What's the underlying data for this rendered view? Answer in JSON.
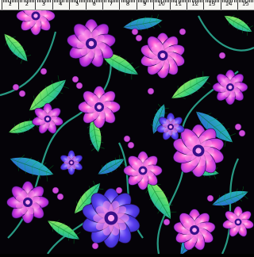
{
  "ruler": {
    "numbers": [
      "1",
      "2",
      "3",
      "4",
      "5",
      "6",
      "7",
      "8",
      "9",
      "10",
      "11",
      "12",
      "13",
      "14",
      "15"
    ]
  },
  "fabric": {
    "background": "#050308",
    "palette": [
      "#7b1fd6",
      "#b43bff",
      "#e040d0",
      "#ff5fd7",
      "#3b3bd8",
      "#1f7fd0",
      "#22b6a6",
      "#3fd27a",
      "#8fe04a",
      "#c6f06a"
    ]
  }
}
